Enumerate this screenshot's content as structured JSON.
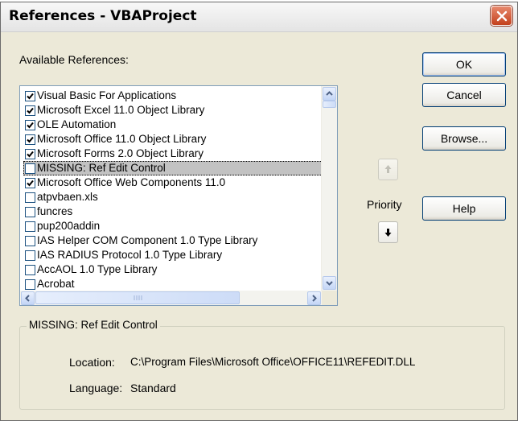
{
  "window": {
    "title": "References - VBAProject"
  },
  "labels": {
    "available_references": "Available References:",
    "priority": "Priority"
  },
  "buttons": {
    "ok": "OK",
    "cancel": "Cancel",
    "browse": "Browse...",
    "help": "Help"
  },
  "references": [
    {
      "label": "Visual Basic For Applications",
      "checked": true
    },
    {
      "label": "Microsoft Excel 11.0 Object Library",
      "checked": true
    },
    {
      "label": "OLE Automation",
      "checked": true
    },
    {
      "label": "Microsoft Office 11.0 Object Library",
      "checked": true
    },
    {
      "label": "Microsoft Forms 2.0 Object Library",
      "checked": true
    },
    {
      "label": "MISSING: Ref Edit Control",
      "checked": false,
      "selected": true
    },
    {
      "label": "Microsoft Office Web Components 11.0",
      "checked": true
    },
    {
      "label": "atpvbaen.xls",
      "checked": false
    },
    {
      "label": "funcres",
      "checked": false
    },
    {
      "label": "pup200addin",
      "checked": false
    },
    {
      "label": "IAS Helper COM Component 1.0 Type Library",
      "checked": false
    },
    {
      "label": "IAS RADIUS Protocol 1.0 Type Library",
      "checked": false
    },
    {
      "label": "AccAOL 1.0 Type Library",
      "checked": false
    },
    {
      "label": "Acrobat",
      "checked": false
    }
  ],
  "details": {
    "title": "MISSING: Ref Edit Control",
    "location_label": "Location:",
    "location_value": "C:\\Program Files\\Microsoft Office\\OFFICE11\\REFEDIT.DLL",
    "language_label": "Language:",
    "language_value": "Standard"
  },
  "icons": {
    "close": "close-icon",
    "check": "checkmark-icon",
    "priority_up": "arrow-up-icon",
    "priority_down": "arrow-down-icon",
    "scroll_up": "scroll-up-arrow-icon",
    "scroll_down": "scroll-down-arrow-icon",
    "scroll_left": "scroll-left-arrow-icon",
    "scroll_right": "scroll-right-arrow-icon"
  },
  "colors": {
    "close_button": "#c3411d",
    "dialog_bg": "#ece9d8",
    "selection": "#c2c2c2"
  }
}
